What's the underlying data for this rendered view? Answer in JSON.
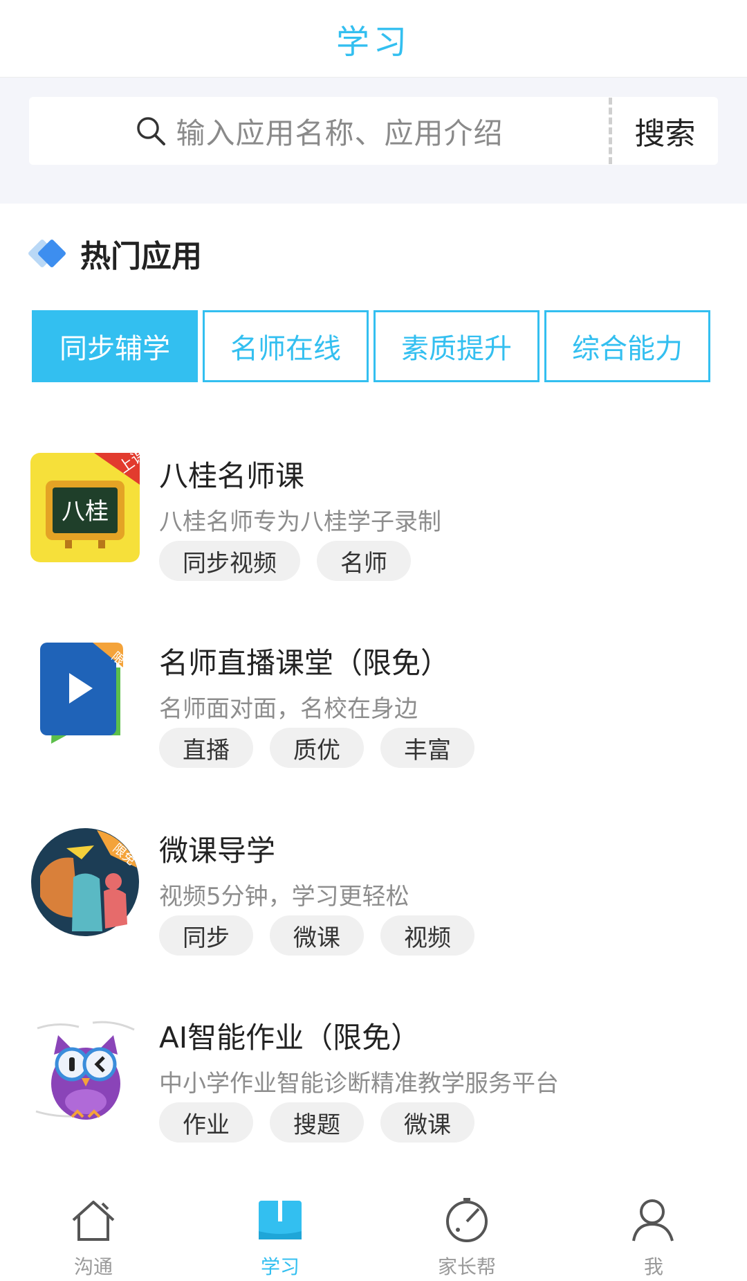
{
  "header": {
    "title": "学习"
  },
  "search": {
    "placeholder": "输入应用名称、应用介绍",
    "button_label": "搜索"
  },
  "section": {
    "title": "热门应用"
  },
  "tabs": [
    {
      "label": "同步辅学",
      "active": true
    },
    {
      "label": "名师在线",
      "active": false
    },
    {
      "label": "素质提升",
      "active": false
    },
    {
      "label": "综合能力",
      "active": false
    }
  ],
  "apps": [
    {
      "title": "八桂名师课",
      "desc": "八桂名师专为八桂学子录制",
      "tags": [
        "同步视频",
        "名师"
      ],
      "badge": "上课",
      "icon_text": "八桂",
      "icon": "blackboard-icon"
    },
    {
      "title": "名师直播课堂（限免）",
      "desc": "名师面对面，名校在身边",
      "tags": [
        "直播",
        "质优",
        "丰富"
      ],
      "badge": "限免",
      "icon": "play-book-icon"
    },
    {
      "title": "微课导学",
      "desc": "视频5分钟，学习更轻松",
      "tags": [
        "同步",
        "微课",
        "视频"
      ],
      "badge": "限免",
      "icon": "micro-lesson-icon"
    },
    {
      "title": "AI智能作业（限免）",
      "desc": "中小学作业智能诊断精准教学服务平台",
      "tags": [
        "作业",
        "搜题",
        "微课"
      ],
      "icon": "owl-icon"
    }
  ],
  "nav": [
    {
      "label": "沟通",
      "icon": "home-icon",
      "active": false
    },
    {
      "label": "学习",
      "icon": "book-icon",
      "active": true
    },
    {
      "label": "家长帮",
      "icon": "compass-icon",
      "active": false
    },
    {
      "label": "我",
      "icon": "user-icon",
      "active": false
    }
  ],
  "colors": {
    "accent": "#33bff0",
    "band": "#f4f5fa",
    "tag_bg": "#f0f0f0"
  }
}
